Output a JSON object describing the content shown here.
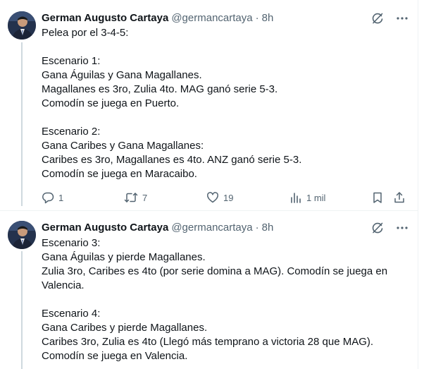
{
  "tweets": [
    {
      "author": "German Augusto Cartaya",
      "handle": "@germancartaya",
      "separator": "·",
      "time": "8h",
      "text": "Pelea por el 3-4-5:\n\nEscenario 1:\nGana Águilas y Gana Magallanes.\nMagallanes es 3ro, Zulia 4to. MAG ganó serie 5-3.\nComodín se juega en Puerto.\n\nEscenario 2:\nGana Caribes y Gana Magallanes:\nCaribes es 3ro, Magallanes es 4to. ANZ ganó serie 5-3.\nComodín se juega en Maracaibo.",
      "stats": {
        "replies": "1",
        "retweets": "7",
        "likes": "19",
        "views": "1 mil"
      }
    },
    {
      "author": "German Augusto Cartaya",
      "handle": "@germancartaya",
      "separator": "·",
      "time": "8h",
      "text": "Escenario 3:\nGana Águilas y pierde Magallanes.\nZulia 3ro, Caribes es 4to (por serie domina a MAG). Comodín se juega en\nValencia.\n\nEscenario 4:\nGana Caribes y pierde Magallanes.\nCaribes 3ro, Zulia es 4to (Llegó más temprano a victoria 28 que MAG).\nComodín se juega en Valencia."
    }
  ],
  "icons": {
    "grok": "grok-icon",
    "more": "more-icon",
    "reply": "reply-icon",
    "retweet": "retweet-icon",
    "like": "like-icon",
    "views": "views-icon",
    "bookmark": "bookmark-icon",
    "share": "share-icon"
  },
  "colors": {
    "text": "#0f1419",
    "secondary": "#536471",
    "thread_line": "#cfd9de",
    "divider": "#eff3f4"
  }
}
